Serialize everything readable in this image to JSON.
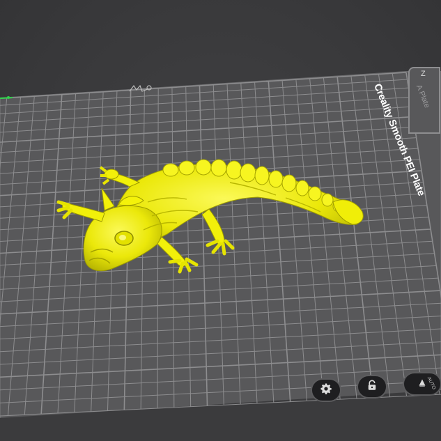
{
  "plate": {
    "label": "Creality Smooth PEI Plate",
    "tab_label": "A Plate",
    "corner_icon": "Z"
  },
  "buttons": {
    "settings_icon": "gear-icon",
    "lock_icon": "lock-icon",
    "auto_label": "AUTO",
    "auto_icon": "auto-orient-icon"
  },
  "colors": {
    "background": "#3a3a3c",
    "plate": "#575759",
    "grid": "#8c8c8e",
    "model": "#f4f20a",
    "model_shadow": "#b6b400",
    "button_bg": "#1e1e20"
  }
}
